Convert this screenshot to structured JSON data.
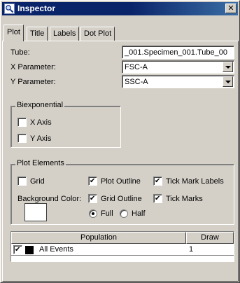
{
  "window": {
    "title": "Inspector",
    "close_glyph": "✕"
  },
  "tabs": [
    {
      "label": "Plot",
      "active": true
    },
    {
      "label": "Title",
      "active": false
    },
    {
      "label": "Labels",
      "active": false
    },
    {
      "label": "Dot Plot",
      "active": false
    }
  ],
  "fields": {
    "tube_label": "Tube:",
    "tube_value": "_001.Specimen_001.Tube_00",
    "x_label": "X Parameter:",
    "x_value": "FSC-A",
    "y_label": "Y Parameter:",
    "y_value": "SSC-A"
  },
  "biexponential": {
    "title": "Biexponential",
    "x_axis": {
      "label": "X Axis",
      "checked": false
    },
    "y_axis": {
      "label": "Y Axis",
      "checked": false
    }
  },
  "plot_elements": {
    "title": "Plot Elements",
    "grid": {
      "label": "Grid",
      "checked": false
    },
    "plot_outline": {
      "label": "Plot Outline",
      "checked": true
    },
    "tick_mark_labels": {
      "label": "Tick Mark Labels",
      "checked": true
    },
    "background_color_label": "Background Color:",
    "background_color": "#ffffff",
    "grid_outline": {
      "label": "Grid Outline",
      "checked": true
    },
    "tick_marks": {
      "label": "Tick Marks",
      "checked": true
    },
    "full": {
      "label": "Full",
      "selected": true
    },
    "half": {
      "label": "Half",
      "selected": false
    }
  },
  "population_table": {
    "headers": [
      "Population",
      "Draw"
    ],
    "rows": [
      {
        "checked": true,
        "color": "#000000",
        "name": "All Events",
        "draw": "1"
      }
    ]
  },
  "colors": {
    "titlebar_start": "#0a246a",
    "titlebar_end": "#3a6ea5",
    "face": "#d4d0c8"
  }
}
